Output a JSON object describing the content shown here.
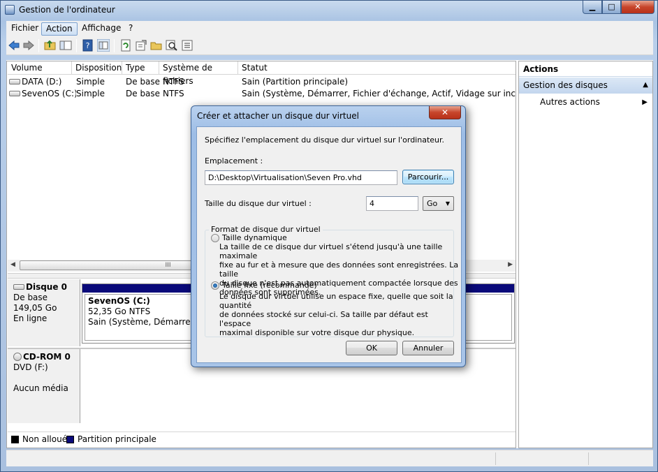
{
  "window": {
    "title": "Gestion de l'ordinateur",
    "controls": {
      "minimize": "▁",
      "maximize": "□",
      "close": "✕"
    }
  },
  "menu": [
    "Fichier",
    "Action",
    "Affichage",
    "?"
  ],
  "toolbar_icons": [
    "back-arrow-icon",
    "forward-arrow-icon",
    "up-folder-icon",
    "show-hide-tree-icon",
    "help-icon",
    "properties-pane-icon",
    "refresh-icon",
    "export-list-icon",
    "open-folder-icon",
    "search-icon",
    "properties-icon"
  ],
  "volumes": {
    "headers": [
      "Volume",
      "Disposition",
      "Type",
      "Système de fichiers",
      "Statut"
    ],
    "rows": [
      {
        "volume": "DATA (D:)",
        "disposition": "Simple",
        "type": "De base",
        "fs": "NTFS",
        "status": "Sain (Partition principale)"
      },
      {
        "volume": "SevenOS (C:)",
        "disposition": "Simple",
        "type": "De base",
        "fs": "NTFS",
        "status": "Sain (Système, Démarrer, Fichier d'échange, Actif, Vidage sur incident, Part"
      }
    ],
    "scroll_grip": "III"
  },
  "disks": [
    {
      "name": "Disque 0",
      "kind": "De base",
      "size": "149,05 Go",
      "state": "En ligne",
      "partition": {
        "title": "SevenOS  (C:)",
        "size": "52,35 Go NTFS",
        "status": "Sain (Système, Démarrer, Fic"
      }
    },
    {
      "name": "CD-ROM 0",
      "kind": "DVD (F:)",
      "state": "Aucun média"
    }
  ],
  "legend": [
    {
      "label": "Non alloué",
      "color": "#000000"
    },
    {
      "label": "Partition principale",
      "color": "#0a0a7a"
    }
  ],
  "actions": {
    "title": "Actions",
    "group": "Gestion des disques",
    "item": "Autres actions"
  },
  "dialog": {
    "title": "Créer et attacher un disque dur virtuel",
    "close": "✕",
    "intro": "Spécifiez l'emplacement du disque dur virtuel sur l'ordinateur.",
    "location_label": "Emplacement :",
    "location_value": "D:\\Desktop\\Virtualisation\\Seven Pro.vhd",
    "browse": "Parcourir...",
    "size_label": "Taille du disque dur virtuel :",
    "size_value": "4",
    "unit": "Go",
    "format_legend": "Format de disque dur virtuel",
    "dynamic": {
      "label": "Taille dynamique",
      "selected": false,
      "desc": [
        "La taille de ce disque dur virtuel s'étend jusqu'à une taille maximale",
        "fixe au fur et à mesure que des données sont enregistrées. La taille",
        "du disque n'est pas automatiquement compactée lorsque des",
        "données sont supprimées."
      ]
    },
    "fixed": {
      "label": "Taille fixe (recommandé)",
      "selected": true,
      "desc": [
        "Le disque dur virtuel utilise un espace fixe, quelle que soit la quantité",
        "de données stocké sur celui-ci. Sa taille par défaut est l'espace",
        "maximal disponible sur votre disque dur physique."
      ]
    },
    "ok": "OK",
    "cancel": "Annuler"
  }
}
